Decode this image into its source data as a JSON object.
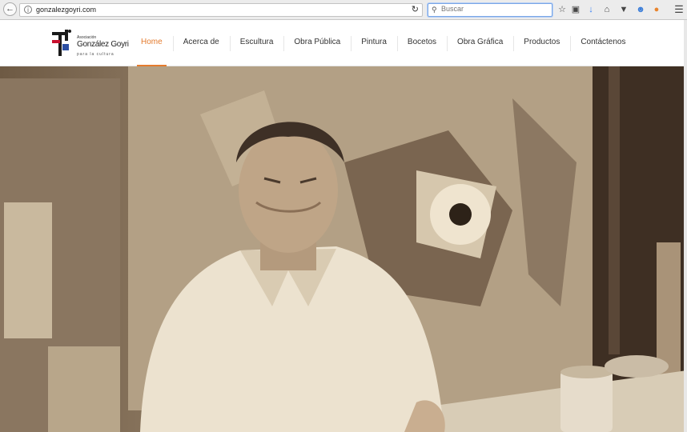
{
  "browser": {
    "url": "gonzalezgoyri.com",
    "search_placeholder": "Buscar"
  },
  "site": {
    "logo": {
      "small": "Asociación",
      "name": "González Goyri",
      "tagline": "para la cultura"
    },
    "nav": [
      {
        "label": "Home"
      },
      {
        "label": "Acerca de"
      },
      {
        "label": "Escultura"
      },
      {
        "label": "Obra Pública"
      },
      {
        "label": "Pintura"
      },
      {
        "label": "Bocetos"
      },
      {
        "label": "Obra Gráfica"
      },
      {
        "label": "Productos"
      },
      {
        "label": "Contáctenos"
      }
    ]
  },
  "colors": {
    "accent": "#e47b2e",
    "toolbar": "#ececec"
  },
  "hero": {
    "tone": "sepia"
  }
}
